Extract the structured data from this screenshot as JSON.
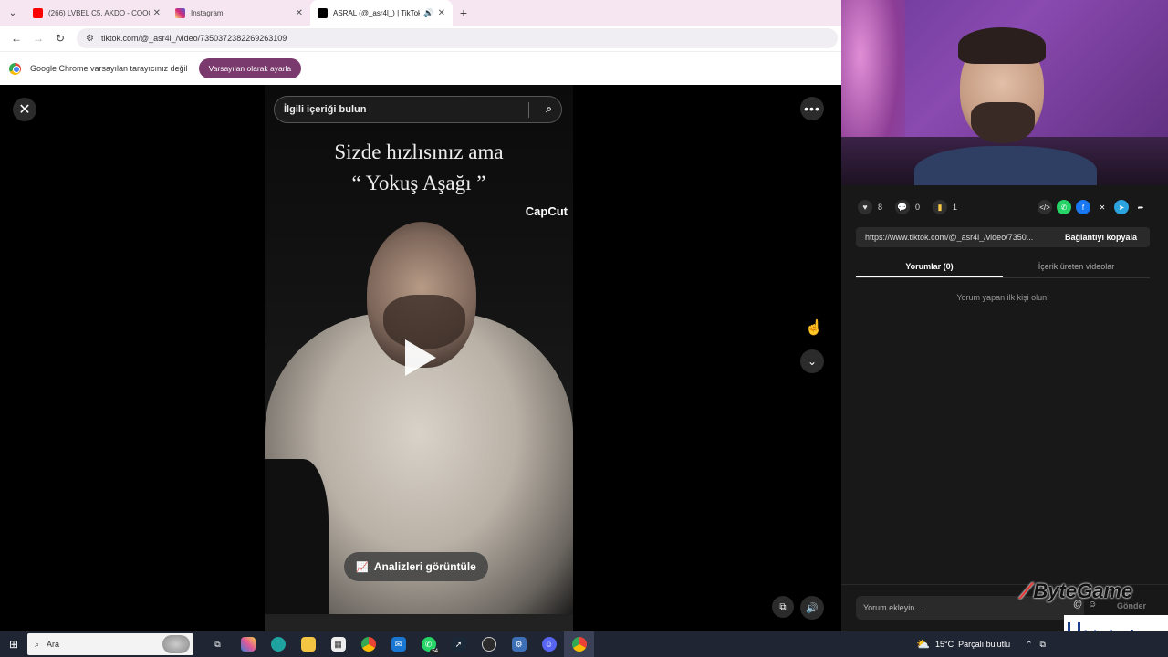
{
  "browser": {
    "tabs": [
      {
        "title": "(266) LVBEL C5, AKDO - COOO!",
        "favicon_color": "#ff0000",
        "close": "✕",
        "active": false
      },
      {
        "title": "Instagram",
        "favicon_color": "#d62976",
        "close": "✕",
        "active": false
      },
      {
        "title": "ASRAL (@_asr4l_) | TikTok",
        "favicon_color": "#000000",
        "close": "✕",
        "active": true
      }
    ],
    "new_tab": "+",
    "tab_menu": "⌄",
    "url": "tiktok.com/@_asr4l_/video/7350372382269263109",
    "infobar_text": "Google Chrome varsayılan tarayıcınız değil",
    "infobar_button": "Varsayılan olarak ayarla"
  },
  "video": {
    "search_placeholder": "İlgili içeriği bulun",
    "caption_line1": "Sizde hızlısınız ama",
    "caption_line2": "“ Yokuş Aşağı ”",
    "watermark": "CapCut",
    "analytics_button": "Analizleri görüntüle"
  },
  "panel": {
    "likes": "8",
    "comments": "0",
    "bookmarks": "1",
    "link": "https://www.tiktok.com/@_asr4l_/video/7350...",
    "copy_link": "Bağlantıyı kopyala",
    "tab_comments": "Yorumlar (0)",
    "tab_creator_videos": "İçerik üreten videolar",
    "empty_comments": "Yorum yapan ilk kişi olun!",
    "comment_placeholder": "Yorum ekleyin...",
    "post": "Gönder"
  },
  "overlays": {
    "bytegame": "ByteGame",
    "unitelog": "Unitelog"
  },
  "taskbar": {
    "search": "Ara",
    "whatsapp_badge": "54",
    "weather_temp": "15°C",
    "weather_desc": "Parçalı bulutlu"
  },
  "colors": {
    "tab_strip": "#f6e6f1",
    "accent_button": "#7b3a6e",
    "panel_bg": "#181818",
    "bookmark": "#f7c948"
  }
}
